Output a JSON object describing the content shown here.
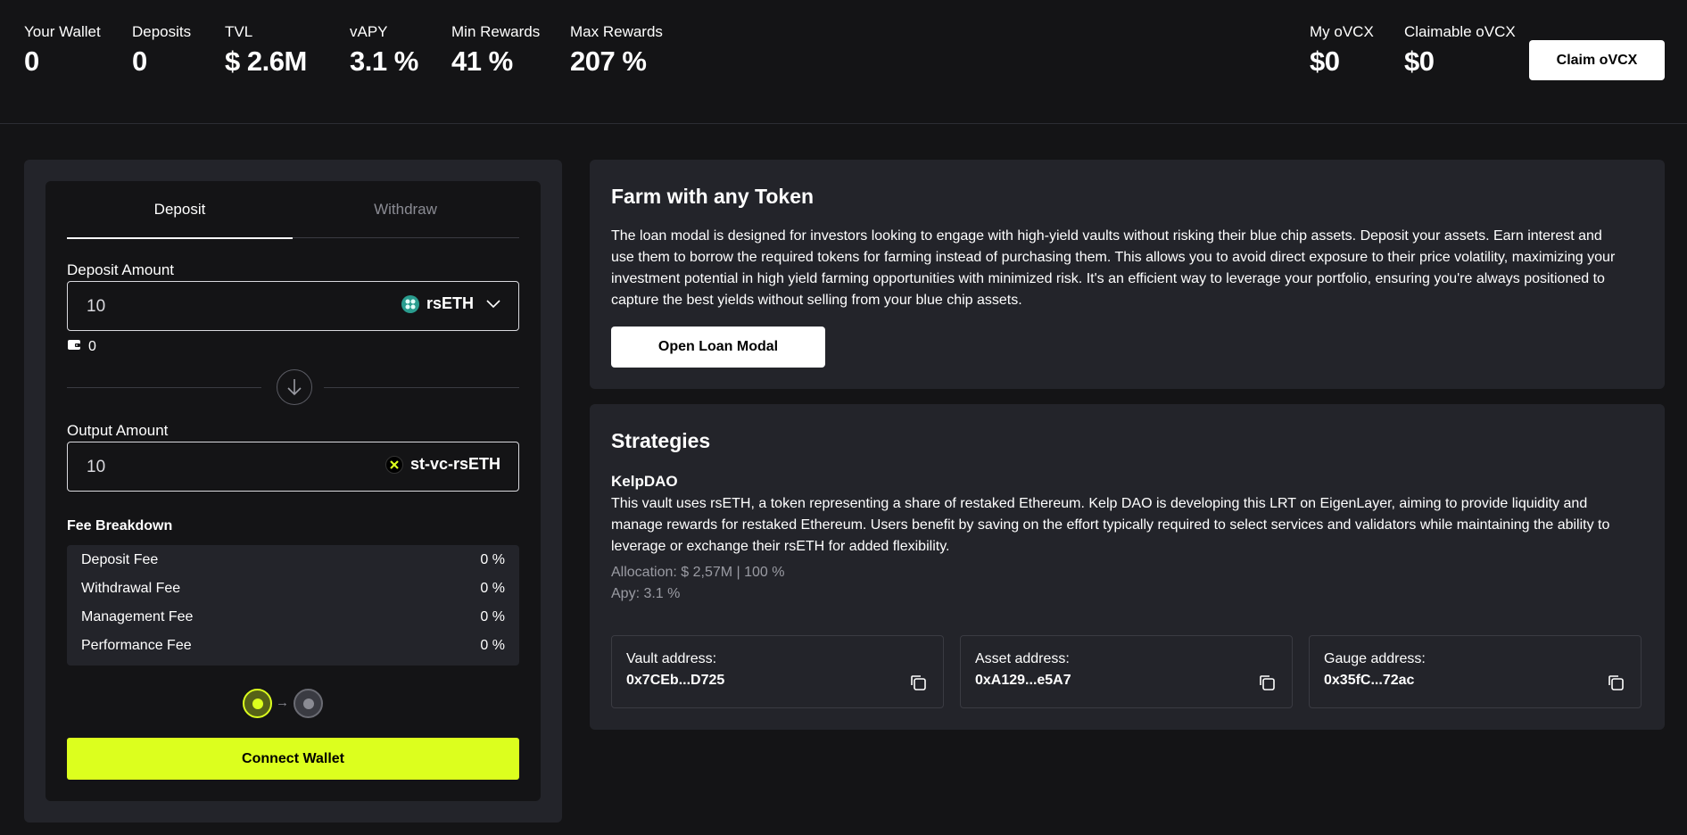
{
  "stats": {
    "wallet": {
      "label": "Your Wallet",
      "value": "0"
    },
    "deposits": {
      "label": "Deposits",
      "value": "0"
    },
    "tvl": {
      "label": "TVL",
      "value": "$ 2.6M"
    },
    "vapy": {
      "label": "vAPY",
      "value": "3.1 %"
    },
    "min_rewards": {
      "label": "Min Rewards",
      "value": "41 %"
    },
    "max_rewards": {
      "label": "Max Rewards",
      "value": "207 %"
    },
    "my_ovcx": {
      "label": "My oVCX",
      "value": "$0"
    },
    "claimable_ovcx": {
      "label": "Claimable oVCX",
      "value": "$0"
    }
  },
  "claim_button": "Claim oVCX",
  "tabs": {
    "deposit": "Deposit",
    "withdraw": "Withdraw"
  },
  "deposit": {
    "label": "Deposit Amount",
    "amount": "10",
    "token": "rsETH",
    "wallet_balance": "0"
  },
  "output": {
    "label": "Output Amount",
    "amount": "10",
    "token": "st-vc-rsETH"
  },
  "fees": {
    "title": "Fee Breakdown",
    "rows": [
      {
        "label": "Deposit Fee",
        "value": "0 %"
      },
      {
        "label": "Withdrawal Fee",
        "value": "0 %"
      },
      {
        "label": "Management Fee",
        "value": "0 %"
      },
      {
        "label": "Performance Fee",
        "value": "0 %"
      }
    ]
  },
  "connect_button": "Connect Wallet",
  "farm": {
    "title": "Farm with any Token",
    "description": "The loan modal is designed for investors looking to engage with high-yield vaults without risking their blue chip assets. Deposit your assets. Earn interest and use them to borrow the required tokens for farming instead of purchasing them. This allows you to avoid direct exposure to their price volatility, maximizing your investment potential in high yield farming opportunities with minimized risk. It's an efficient way to leverage your portfolio, ensuring you're always positioned to capture the best yields without selling from your blue chip assets.",
    "button": "Open Loan Modal"
  },
  "strategies": {
    "title": "Strategies",
    "name": "KelpDAO",
    "description": "This vault uses rsETH, a token representing a share of restaked Ethereum. Kelp DAO is developing this LRT on EigenLayer, aiming to provide liquidity and manage rewards for restaked Ethereum. Users benefit by saving on the effort typically required to select services and validators while maintaining the ability to leverage or exchange their rsETH for added flexibility.",
    "allocation": "Allocation: $ 2,57M | 100 %",
    "apy": "Apy: 3.1 %",
    "addresses": [
      {
        "label": "Vault address:",
        "value": "0x7CEb...D725"
      },
      {
        "label": "Asset address:",
        "value": "0xA129...e5A7"
      },
      {
        "label": "Gauge address:",
        "value": "0x35fC...72ac"
      }
    ]
  },
  "colors": {
    "accent": "#dcff1e",
    "background": "#141416",
    "card": "#23242a"
  },
  "icons": {
    "wallet": "wallet-icon",
    "chevron": "chevron-down-icon",
    "arrow": "arrow-down-icon",
    "copy": "copy-icon"
  }
}
